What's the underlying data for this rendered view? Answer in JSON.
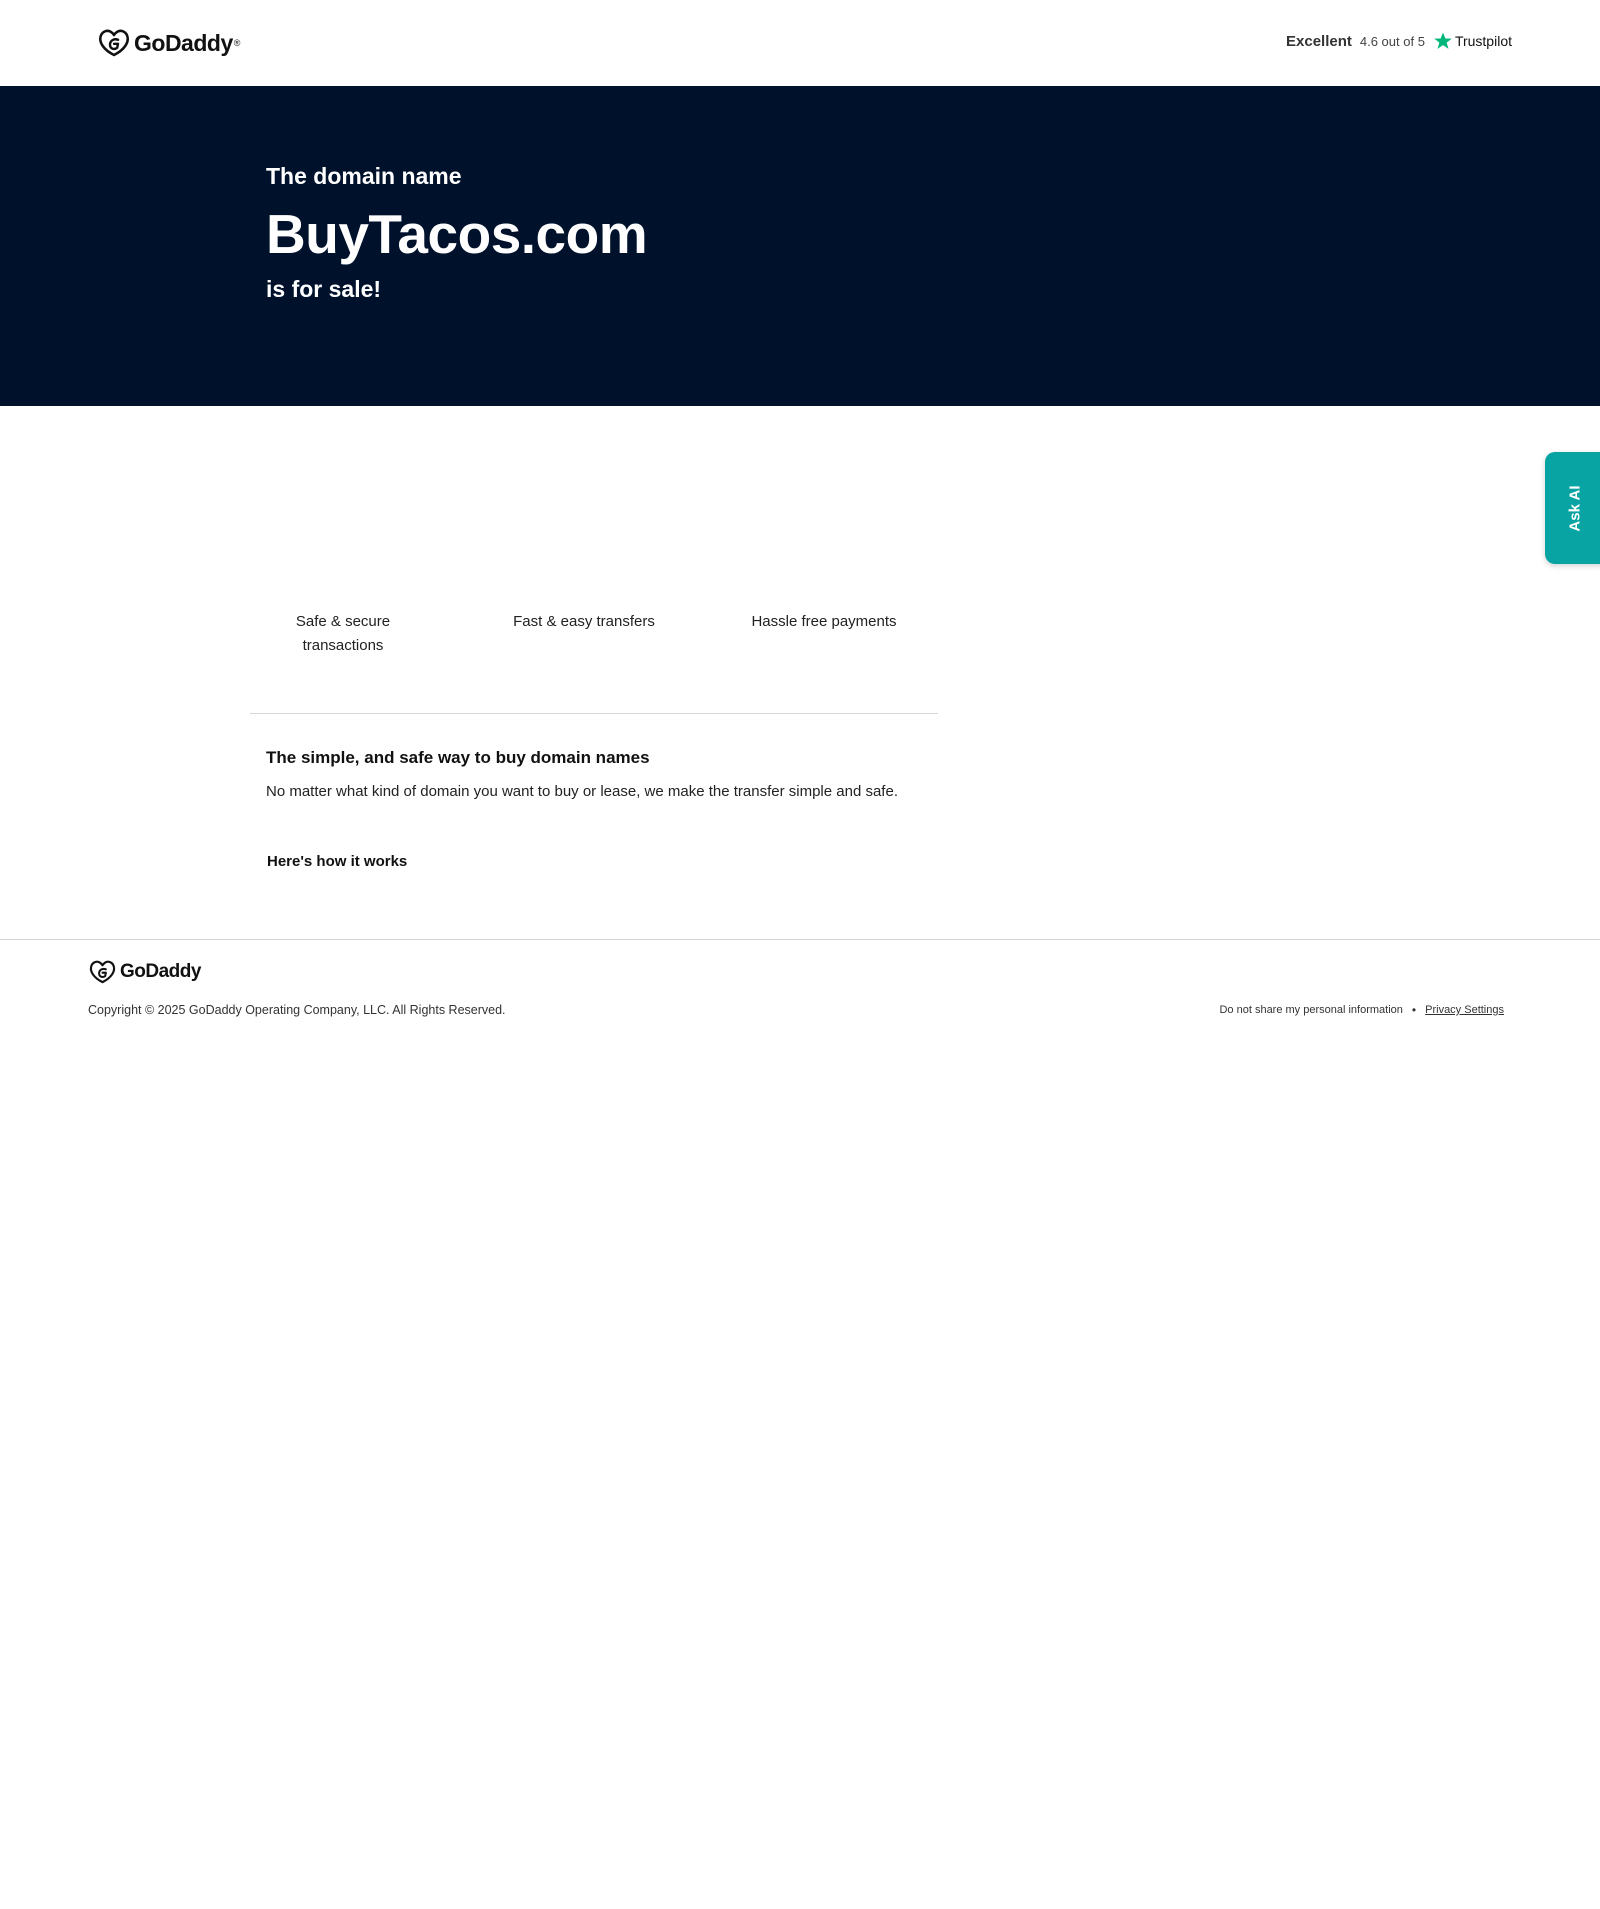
{
  "header": {
    "brand": "GoDaddy",
    "trademark": "®",
    "trustpilot": {
      "label": "Excellent",
      "rating_text": "4.6 out of 5",
      "brand": "Trustpilot",
      "star_color": "#00b67a"
    }
  },
  "hero": {
    "pre_title": "The domain name",
    "domain": "BuyTacos.com",
    "post_title": "is for sale!",
    "background": "#00112c"
  },
  "ask_ai": {
    "label": "Ask AI",
    "color": "#08a3a3"
  },
  "features": [
    {
      "label": "Safe & secure transactions"
    },
    {
      "label": "Fast & easy transfers"
    },
    {
      "label": "Hassle free payments"
    }
  ],
  "info": {
    "title": "The simple, and safe way to buy domain names",
    "body": "No matter what kind of domain you want to buy or lease, we make the transfer simple and safe.",
    "how_link": "Here's how it works"
  },
  "footer": {
    "brand": "GoDaddy",
    "copyright": "Copyright © 2025 GoDaddy Operating Company, LLC. All Rights Reserved.",
    "do_not_share": "Do not share my personal information",
    "separator": "•",
    "privacy_settings": "Privacy Settings"
  }
}
